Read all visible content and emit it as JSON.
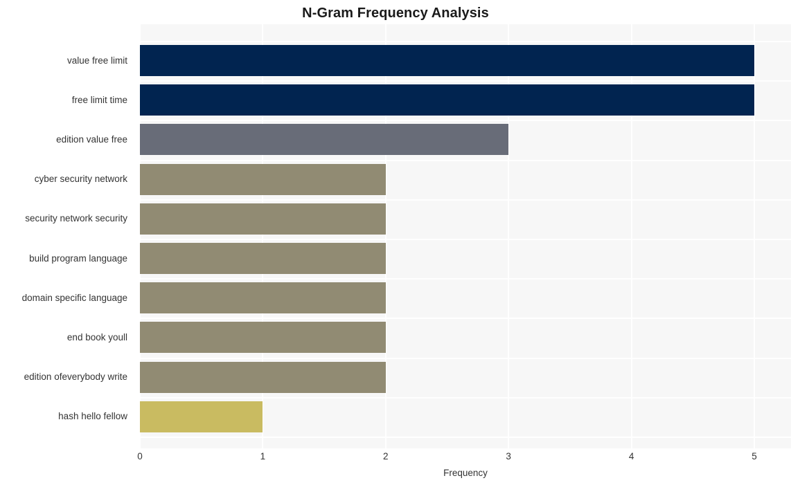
{
  "chart_data": {
    "type": "bar",
    "orientation": "horizontal",
    "title": "N-Gram Frequency Analysis",
    "xlabel": "Frequency",
    "ylabel": "",
    "categories": [
      "value free limit",
      "free limit time",
      "edition value free",
      "cyber security network",
      "security network security",
      "build program language",
      "domain specific language",
      "end book youll",
      "edition ofeverybody write",
      "hash hello fellow"
    ],
    "values": [
      5,
      5,
      3,
      2,
      2,
      2,
      2,
      2,
      2,
      1
    ],
    "bar_colors": [
      "#012450",
      "#012450",
      "#686c78",
      "#918b73",
      "#918b73",
      "#918b73",
      "#918b73",
      "#918b73",
      "#918b73",
      "#c9bb61"
    ],
    "xlim": [
      0,
      5
    ],
    "xticks": [
      0,
      1,
      2,
      3,
      4,
      5
    ],
    "xtick_labels": [
      "0",
      "1",
      "2",
      "3",
      "4",
      "5"
    ],
    "grid": true,
    "grid_color": "#ffffff",
    "plot_background": "#f7f7f7",
    "figure_background": "#ffffff",
    "legend": null
  },
  "colors": {
    "accent_dark": "#012450",
    "accent_gray": "#686c78",
    "accent_khaki": "#918b73",
    "accent_yellow": "#c9bb61",
    "text": "#333333",
    "title_text": "#1a1a1a"
  }
}
